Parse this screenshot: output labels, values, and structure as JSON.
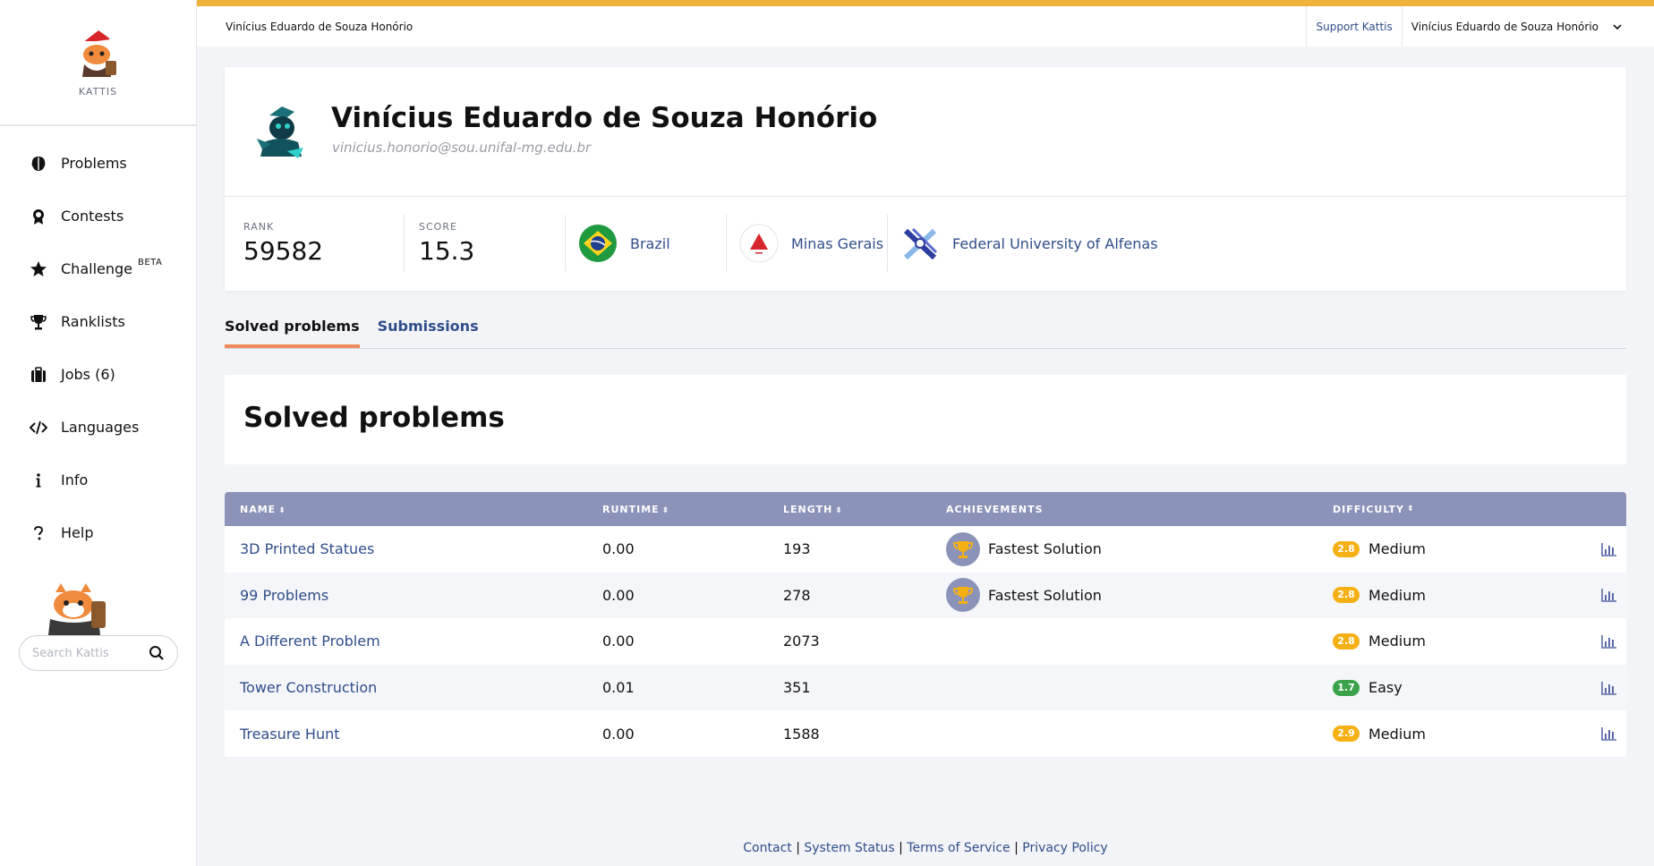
{
  "brand": {
    "name": "KATTIS"
  },
  "nav": [
    {
      "label": "Problems",
      "icon": "brain-icon"
    },
    {
      "label": "Contests",
      "icon": "medal-icon"
    },
    {
      "label": "Challenge",
      "icon": "star-icon",
      "badge": "BETA"
    },
    {
      "label": "Ranklists",
      "icon": "trophy-icon"
    },
    {
      "label": "Jobs (6)",
      "icon": "briefcase-icon"
    },
    {
      "label": "Languages",
      "icon": "code-icon"
    },
    {
      "label": "Info",
      "icon": "info-icon"
    },
    {
      "label": "Help",
      "icon": "question-icon"
    }
  ],
  "search": {
    "placeholder": "Search Kattis"
  },
  "topbar": {
    "user": "Vinícius Eduardo de Souza Honório",
    "support": "Support Kattis",
    "account": "Vinícius Eduardo de Souza Honório"
  },
  "profile": {
    "name": "Vinícius Eduardo de Souza Honório",
    "email": "vinicius.honorio@sou.unifal-mg.edu.br",
    "rank_label": "RANK",
    "rank": "59582",
    "score_label": "SCORE",
    "score": "15.3",
    "country": "Brazil",
    "region": "Minas Gerais",
    "university": "Federal University of Alfenas"
  },
  "tabs": {
    "solved": "Solved problems",
    "submissions": "Submissions"
  },
  "solved_title": "Solved problems",
  "table": {
    "headers": {
      "name": "NAME",
      "runtime": "RUNTIME",
      "length": "LENGTH",
      "achievements": "ACHIEVEMENTS",
      "difficulty": "DIFFICULTY"
    },
    "rows": [
      {
        "name": "3D Printed Statues",
        "runtime": "0.00",
        "length": "193",
        "achievement": "Fastest Solution",
        "diff_score": "2.8",
        "diff_label": "Medium"
      },
      {
        "name": "99 Problems",
        "runtime": "0.00",
        "length": "278",
        "achievement": "Fastest Solution",
        "diff_score": "2.8",
        "diff_label": "Medium"
      },
      {
        "name": "A Different Problem",
        "runtime": "0.00",
        "length": "2073",
        "achievement": "",
        "diff_score": "2.8",
        "diff_label": "Medium"
      },
      {
        "name": "Tower Construction",
        "runtime": "0.01",
        "length": "351",
        "achievement": "",
        "diff_score": "1.7",
        "diff_label": "Easy"
      },
      {
        "name": "Treasure Hunt",
        "runtime": "0.00",
        "length": "1588",
        "achievement": "",
        "diff_score": "2.9",
        "diff_label": "Medium"
      }
    ]
  },
  "footer": {
    "contact": "Contact",
    "status": "System Status",
    "terms": "Terms of Service",
    "privacy": "Privacy Policy",
    "sep": "|"
  },
  "colors": {
    "accent": "#f0b23a",
    "link": "#2f4e8a",
    "header": "#8b93b8",
    "medium": "#f5b014",
    "easy": "#3aa34a",
    "tab_underline": "#f08a5d"
  }
}
